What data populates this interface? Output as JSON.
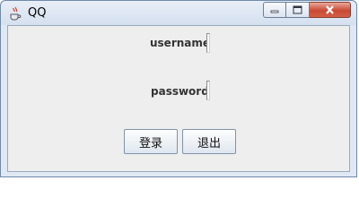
{
  "window": {
    "title": "QQ",
    "icons": {
      "app": "java-coffee-cup-icon",
      "minimize": "minimize-icon",
      "maximize": "maximize-icon",
      "close": "close-icon"
    }
  },
  "form": {
    "username_label": "username",
    "username_value": "",
    "password_label": "password",
    "password_value": ""
  },
  "buttons": {
    "login": "登录",
    "exit": "退出"
  }
}
